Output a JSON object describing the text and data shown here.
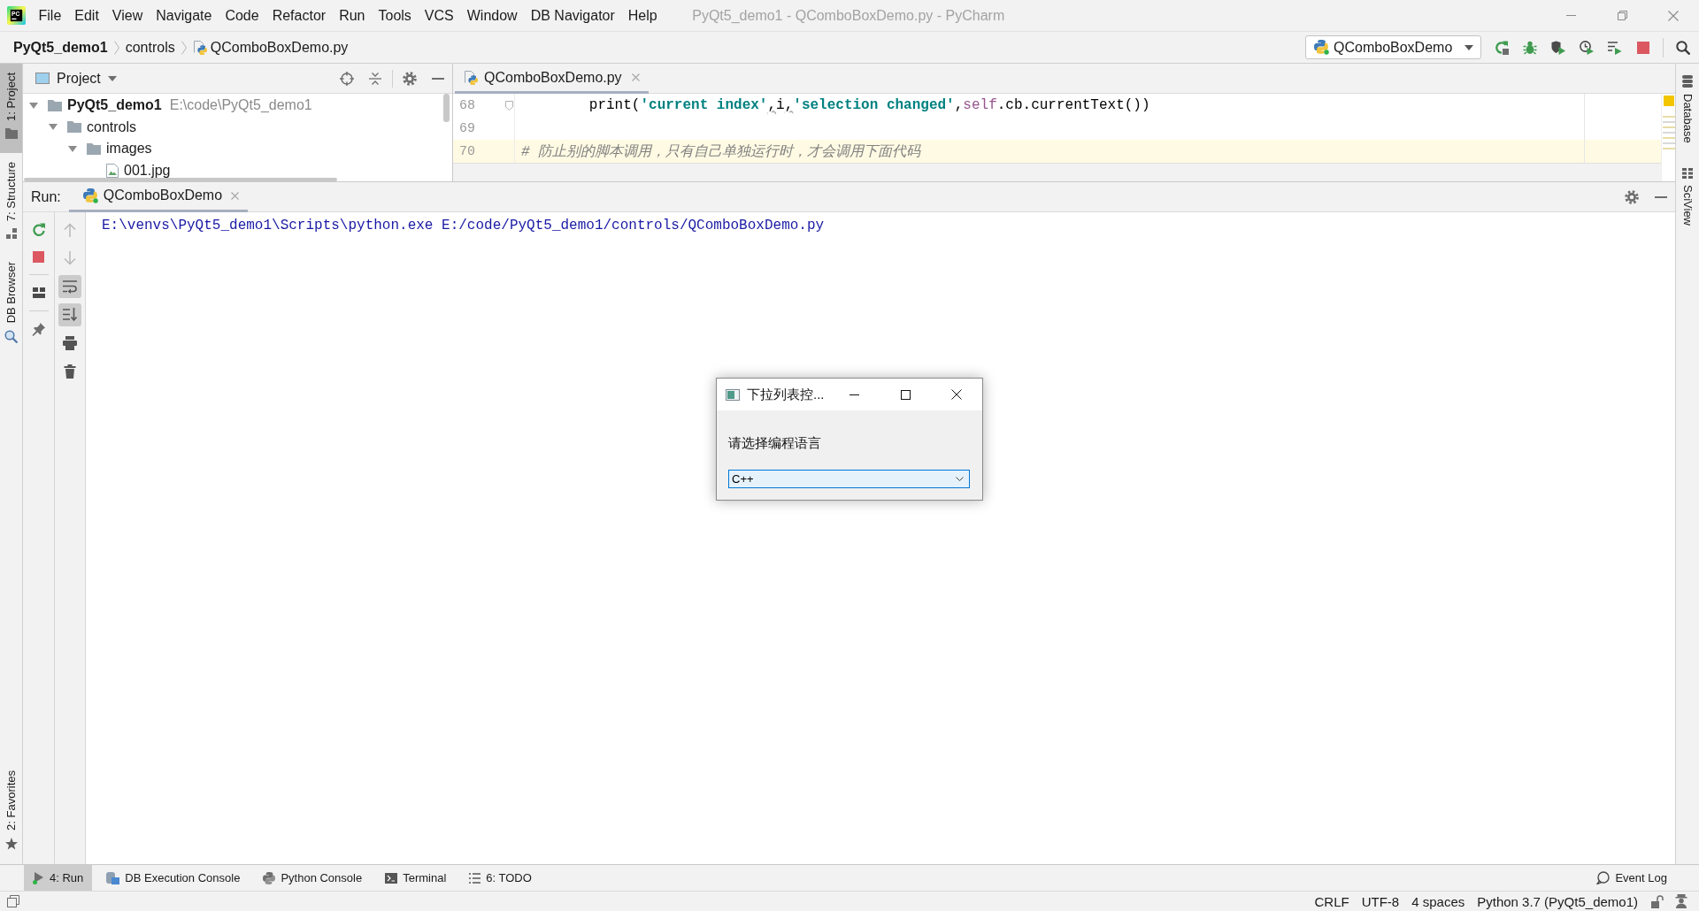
{
  "menu_bar": {
    "logo_text": "PC",
    "items": [
      {
        "label": "File"
      },
      {
        "label": "Edit"
      },
      {
        "label": "View"
      },
      {
        "label": "Navigate"
      },
      {
        "label": "Code"
      },
      {
        "label": "Refactor"
      },
      {
        "label": "Run"
      },
      {
        "label": "Tools"
      },
      {
        "label": "VCS"
      },
      {
        "label": "Window"
      },
      {
        "label": "DB Navigator"
      },
      {
        "label": "Help"
      }
    ],
    "window_title": "PyQt5_demo1 - QComboBoxDemo.py - PyCharm"
  },
  "navigation_bar": {
    "breadcrumbs": [
      {
        "label": "PyQt5_demo1",
        "kind": "project"
      },
      {
        "label": "controls",
        "kind": "folder"
      },
      {
        "label": "QComboBoxDemo.py",
        "kind": "python-file"
      }
    ],
    "run_configuration": "QComboBoxDemo"
  },
  "left_tool_strip": {
    "top": [
      {
        "label": "1: Project",
        "selected": true
      },
      {
        "label": "7: Structure",
        "selected": false
      },
      {
        "label": "DB Browser",
        "selected": false
      }
    ],
    "bottom": [
      {
        "label": "2: Favorites",
        "selected": false
      }
    ]
  },
  "project_panel": {
    "title": "Project",
    "tree": [
      {
        "label": "PyQt5_demo1",
        "path": "E:\\code\\PyQt5_demo1",
        "kind": "folder",
        "expanded": true,
        "children": [
          {
            "label": "controls",
            "kind": "folder",
            "expanded": true,
            "children": [
              {
                "label": "images",
                "kind": "folder",
                "expanded": true,
                "children": [
                  {
                    "label": "001.jpg",
                    "kind": "image"
                  }
                ]
              }
            ]
          }
        ]
      }
    ]
  },
  "editor": {
    "tabs": [
      {
        "label": "QComboBoxDemo.py",
        "selected": true
      }
    ],
    "lines": [
      {
        "number": "68",
        "current": false,
        "fold_marker": true,
        "indented": true,
        "tokens": [
          {
            "kind": "plain",
            "text": "print("
          },
          {
            "kind": "string",
            "text": "'current index'"
          },
          {
            "kind": "warning",
            "text": ","
          },
          {
            "kind": "plain",
            "text": "i"
          },
          {
            "kind": "warning",
            "text": ","
          },
          {
            "kind": "string",
            "text": "'selection changed'"
          },
          {
            "kind": "plain",
            "text": ","
          },
          {
            "kind": "self",
            "text": "self"
          },
          {
            "kind": "plain",
            "text": ".cb.currentText())"
          }
        ]
      },
      {
        "number": "69",
        "current": false
      },
      {
        "number": "70",
        "current": true,
        "indented": false,
        "tokens": [
          {
            "kind": "comment",
            "text": "# 防止别的脚本调用，只有自己单独运行时，才会调用下面代码"
          }
        ]
      }
    ]
  },
  "right_tool_strip": [
    {
      "label": "Database",
      "selected": false
    },
    {
      "label": "SciView",
      "selected": false
    }
  ],
  "run_panel": {
    "label": "Run:",
    "tabs": [
      {
        "label": "QComboBoxDemo",
        "selected": true
      }
    ],
    "console_tools": [
      {
        "disabled": true,
        "on": false
      },
      {
        "disabled": true,
        "on": false
      },
      {
        "disabled": false,
        "on": true
      },
      {
        "disabled": false,
        "on": true
      },
      {
        "disabled": false,
        "on": false
      },
      {
        "disabled": false,
        "on": false
      }
    ],
    "output": [
      "E:\\venvs\\PyQt5_demo1\\Scripts\\python.exe E:/code/PyQt5_demo1/controls/QComboBoxDemo.py"
    ]
  },
  "dialog": {
    "title": "下拉列表控...",
    "prompt": "请选择编程语言",
    "combo": {
      "value": "C++",
      "focused": true
    }
  },
  "bottom_bar": {
    "tools": [
      {
        "label": "4: Run",
        "selected": true
      },
      {
        "label": "DB Execution Console",
        "selected": false
      },
      {
        "label": "Python Console",
        "selected": false
      },
      {
        "label": "Terminal",
        "selected": false
      },
      {
        "label": "6: TODO",
        "selected": false
      }
    ],
    "event_log": "Event Log"
  },
  "status_bar": {
    "items": [
      "CRLF",
      "UTF-8",
      "4 spaces",
      "Python 3.7 (PyQt5_demo1)"
    ]
  }
}
